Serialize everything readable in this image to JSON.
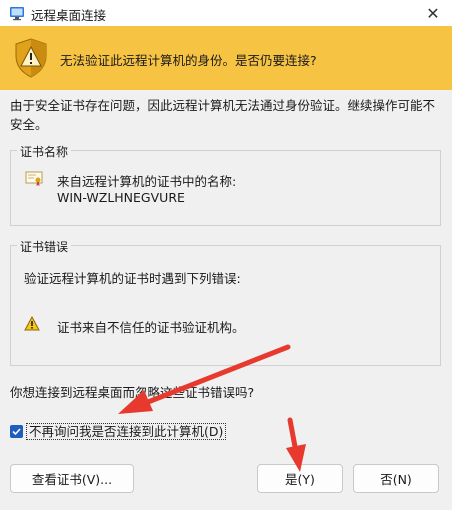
{
  "window": {
    "title": "远程桌面连接",
    "close_glyph": "✕"
  },
  "banner": {
    "text": "无法验证此远程计算机的身份。是否仍要连接?"
  },
  "intro": "由于安全证书存在问题，因此远程计算机无法通过身份验证。继续操作可能不安全。",
  "cert_name_group": {
    "label": "证书名称",
    "from_text": "来自远程计算机的证书中的名称:",
    "name": "WIN-WZLHNEGVURE"
  },
  "cert_error_group": {
    "label": "证书错误",
    "intro": "验证远程计算机的证书时遇到下列错误:",
    "error": "证书来自不信任的证书验证机构。"
  },
  "question": "你想连接到远程桌面而忽略这些证书错误吗?",
  "checkbox": {
    "label": "不再询问我是否连接到此计算机(D)",
    "checked": true
  },
  "buttons": {
    "view_cert": "查看证书(V)...",
    "yes": "是(Y)",
    "no": "否(N)"
  },
  "colors": {
    "banner": "#f7c343",
    "checkbox_accent": "#1f5dbf",
    "annotation_arrow": "#e8392e"
  }
}
